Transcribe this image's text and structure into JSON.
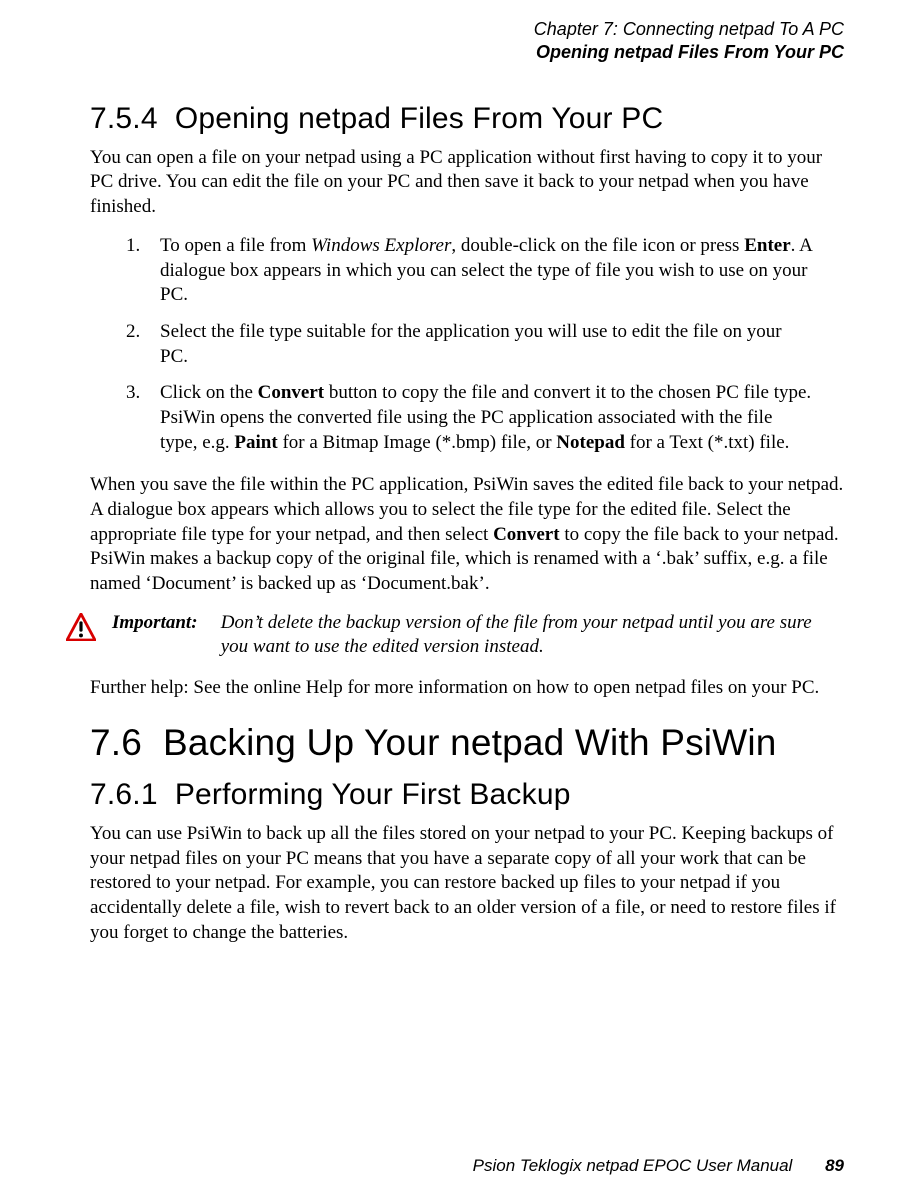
{
  "header": {
    "chapter_line": "Chapter 7:  Connecting netpad To A PC",
    "sub_line": "Opening netpad Files From Your PC"
  },
  "s754": {
    "number": "7.5.4",
    "title": "Opening netpad Files From Your PC",
    "intro": "You can open a file on your netpad using a PC application without first having to copy it to your PC drive. You can edit the file on your PC and then save it back to your netpad when you have finished.",
    "steps": [
      {
        "num": "1.",
        "pre": "To open a file from ",
        "em": "Windows Explorer",
        "mid": ", double-click on the file icon or press ",
        "b1": "Enter",
        "post": ". A dialogue box appears in which you can select the type of file you wish to use on your PC."
      },
      {
        "num": "2.",
        "text": "Select the file type suitable for the application you will use to edit the file on your PC."
      },
      {
        "num": "3.",
        "pre": "Click on the ",
        "b1": "Convert",
        "mid1": " button to copy the file and convert it to the chosen PC file type. PsiWin opens the converted file using the PC application associated with the file type, e.g. ",
        "b2": "Paint",
        "mid2": " for a Bitmap Image (*.bmp) file, or ",
        "b3": "Notepad",
        "post": " for a Text (*.txt) file."
      }
    ],
    "after_pre": "When you save the file within the PC application, PsiWin saves the edited file back to your netpad. A dialogue box appears which allows you to select the file type for the edited file. Select the appropriate file type for your netpad, and then select ",
    "after_b": "Convert",
    "after_post": " to copy the file back to your netpad. PsiWin makes a backup copy of the original file, which is renamed with a ‘.bak’ suffix, e.g. a file named ‘Document’ is backed up as ‘Document.bak’.",
    "important_label": "Important:",
    "important_body": "Don’t delete the backup version of the file from your netpad until you are sure you want to use the edited version instead.",
    "further": "Further help: See the online Help for more information on how to open netpad files on your PC."
  },
  "s76": {
    "number": "7.6",
    "title": "Backing Up Your netpad With PsiWin"
  },
  "s761": {
    "number": "7.6.1",
    "title": "Performing Your First Backup",
    "body": "You can use PsiWin to back up all the files stored on your netpad to your PC. Keeping backups of your netpad files on your PC means that you have a separate copy of all your work that can be restored to your netpad. For example, you can restore backed up files to your netpad if you accidentally delete a file, wish to revert back to an older version of a file, or need to restore files if you forget to change the batteries."
  },
  "footer": {
    "manual_title": "Psion Teklogix netpad EPOC User Manual",
    "page_number": "89"
  }
}
